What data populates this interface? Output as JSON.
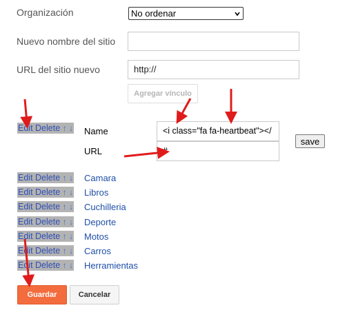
{
  "form": {
    "org_label": "Organización",
    "org_value": "No ordenar",
    "new_name_label": "Nuevo nombre del sitio",
    "new_name_value": "",
    "new_url_label": "URL del sitio nuevo",
    "new_url_value": "http://",
    "add_link_label": "Agregar vínculo"
  },
  "edit_row": {
    "edit": "Edit",
    "delete": "Delete",
    "up": "↑",
    "down": "↓",
    "name_label": "Name",
    "name_value": "<i class=\"fa fa-heartbeat\"></",
    "url_label": "URL",
    "url_value": "#",
    "save_label": "save"
  },
  "links": [
    {
      "edit": "Edit",
      "delete": "Delete",
      "up": "↑",
      "down": "↓",
      "label": "Camara"
    },
    {
      "edit": "Edit",
      "delete": "Delete",
      "up": "↑",
      "down": "↓",
      "label": "Libros"
    },
    {
      "edit": "Edit",
      "delete": "Delete",
      "up": "↑",
      "down": "↓",
      "label": "Cuchilleria"
    },
    {
      "edit": "Edit",
      "delete": "Delete",
      "up": "↑",
      "down": "↓",
      "label": "Deporte"
    },
    {
      "edit": "Edit",
      "delete": "Delete",
      "up": "↑",
      "down": "↓",
      "label": "Motos"
    },
    {
      "edit": "Edit",
      "delete": "Delete",
      "up": "↑",
      "down": "↓",
      "label": "Carros"
    },
    {
      "edit": "Edit",
      "delete": "Delete",
      "up": "↑",
      "down": "↓",
      "label": "Herramientas"
    }
  ],
  "footer": {
    "save_label": "Guardar",
    "cancel_label": "Cancelar"
  },
  "colors": {
    "annotation_arrow": "#e01b1b",
    "primary_button": "#f36c3d",
    "link": "#1f4fa8"
  },
  "icons": {
    "select_chevron": "chevron-down-icon",
    "annotation": "red-arrow-icon"
  }
}
